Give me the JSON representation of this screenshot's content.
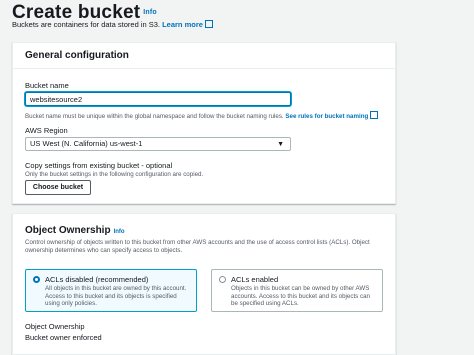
{
  "header": {
    "title": "Create bucket",
    "info": "Info",
    "subtitle": "Buckets are containers for data stored in S3.",
    "learn_more": "Learn more",
    "external_icon": "external-link-icon"
  },
  "general": {
    "title": "General configuration",
    "bucket_name_label": "Bucket name",
    "bucket_name_value": "websitesource2",
    "bucket_name_help": "Bucket name must be unique within the global namespace and follow the bucket naming rules.",
    "rules_link": "See rules for bucket naming",
    "region_label": "AWS Region",
    "region_value": "US West (N. California) us-west-1",
    "copy_label": "Copy settings from existing bucket - optional",
    "copy_help": "Only the bucket settings in the following configuration are copied.",
    "choose_button": "Choose bucket"
  },
  "ownership": {
    "title": "Object Ownership",
    "info": "Info",
    "description": "Control ownership of objects written to this bucket from other AWS accounts and the use of access control lists (ACLs). Object ownership determines who can specify access to objects.",
    "options": [
      {
        "label": "ACLs disabled (recommended)",
        "description": "All objects in this bucket are owned by this account. Access to this bucket and its objects is specified using only policies.",
        "selected": true
      },
      {
        "label": "ACLs enabled",
        "description": "Objects in this bucket can be owned by other AWS accounts. Access to this bucket and its objects can be specified using ACLs.",
        "selected": false
      }
    ],
    "status_label": "Object Ownership",
    "status_value": "Bucket owner enforced"
  },
  "colors": {
    "link": "#0073bb",
    "focus": "#00a1c9",
    "background": "#f2f3f3"
  }
}
